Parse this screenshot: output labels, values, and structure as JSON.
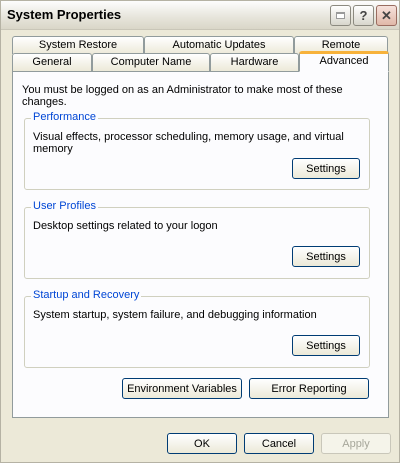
{
  "window": {
    "title": "System Properties"
  },
  "title_buttons": {
    "help": "?",
    "close": "✕"
  },
  "tabs": {
    "row1": [
      "System Restore",
      "Automatic Updates",
      "Remote"
    ],
    "row2": [
      "General",
      "Computer Name",
      "Hardware",
      "Advanced"
    ],
    "active": "Advanced"
  },
  "panel": {
    "intro": "You must be logged on as an Administrator to make most of these changes.",
    "performance": {
      "title": "Performance",
      "desc": "Visual effects, processor scheduling, memory usage, and virtual memory",
      "button": "Settings"
    },
    "profiles": {
      "title": "User Profiles",
      "desc": "Desktop settings related to your logon",
      "button": "Settings"
    },
    "startup": {
      "title": "Startup and Recovery",
      "desc": "System startup, system failure, and debugging information",
      "button": "Settings"
    },
    "env_button": "Environment Variables",
    "error_button": "Error Reporting"
  },
  "footer": {
    "ok": "OK",
    "cancel": "Cancel",
    "apply": "Apply"
  }
}
